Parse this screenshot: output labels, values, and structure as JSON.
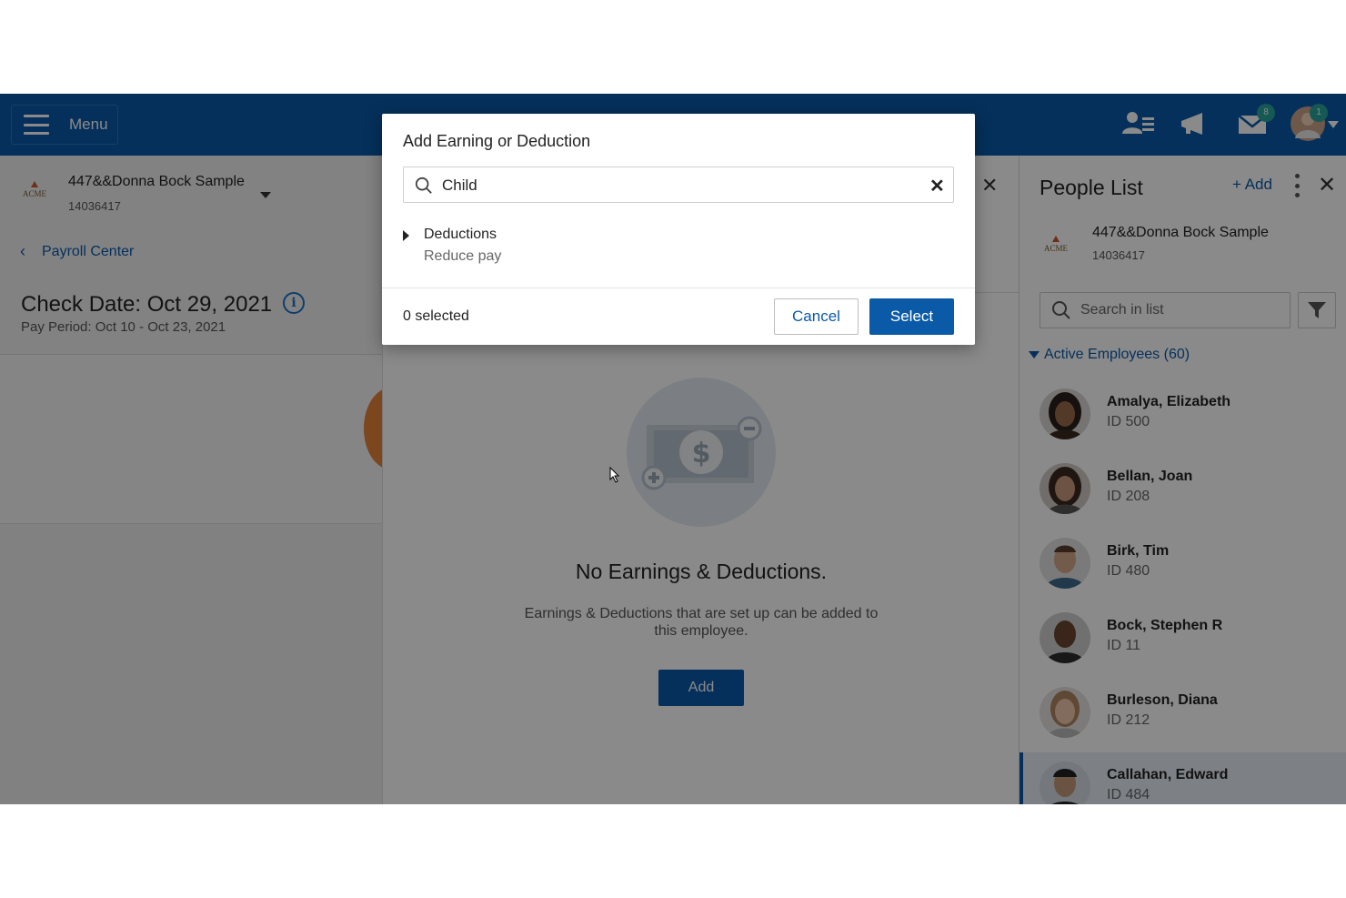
{
  "topbar": {
    "menu_label": "Menu",
    "mail_badge": "8",
    "avatar_badge": "1"
  },
  "left_panel": {
    "company_logo_text": "ACME",
    "company_name": "447&&Donna Bock Sample",
    "company_id": "14036417",
    "back_link": "Payroll Center",
    "check_date": "Check Date: Oct 29, 2021",
    "pay_period": "Pay Period: Oct 10 - Oct 23, 2021"
  },
  "center_panel": {
    "empty_title": "No Earnings & Deductions.",
    "empty_description": "Earnings & Deductions that are set up can be added to this employee.",
    "add_button": "Add"
  },
  "people_list": {
    "title": "People List",
    "add_label": "+ Add",
    "company_logo_text": "ACME",
    "company_name": "447&&Donna Bock Sample",
    "company_id": "14036417",
    "search_placeholder": "Search in list",
    "group_label": "Active Employees (60)",
    "employees": [
      {
        "name": "Amalya, Elizabeth",
        "id": "ID 500"
      },
      {
        "name": "Bellan, Joan",
        "id": "ID 208"
      },
      {
        "name": "Birk, Tim",
        "id": "ID 480"
      },
      {
        "name": "Bock, Stephen R",
        "id": "ID 11"
      },
      {
        "name": "Burleson, Diana",
        "id": "ID 212"
      },
      {
        "name": "Callahan, Edward",
        "id": "ID 484"
      }
    ]
  },
  "modal": {
    "title": "Add Earning or Deduction",
    "search_value": "Child",
    "group_label": "Deductions",
    "group_sublabel": "Reduce pay",
    "selected_count": "0 selected",
    "cancel_label": "Cancel",
    "select_label": "Select"
  },
  "colors": {
    "brand": "#0a5aa8",
    "badge": "#2aa39a"
  }
}
